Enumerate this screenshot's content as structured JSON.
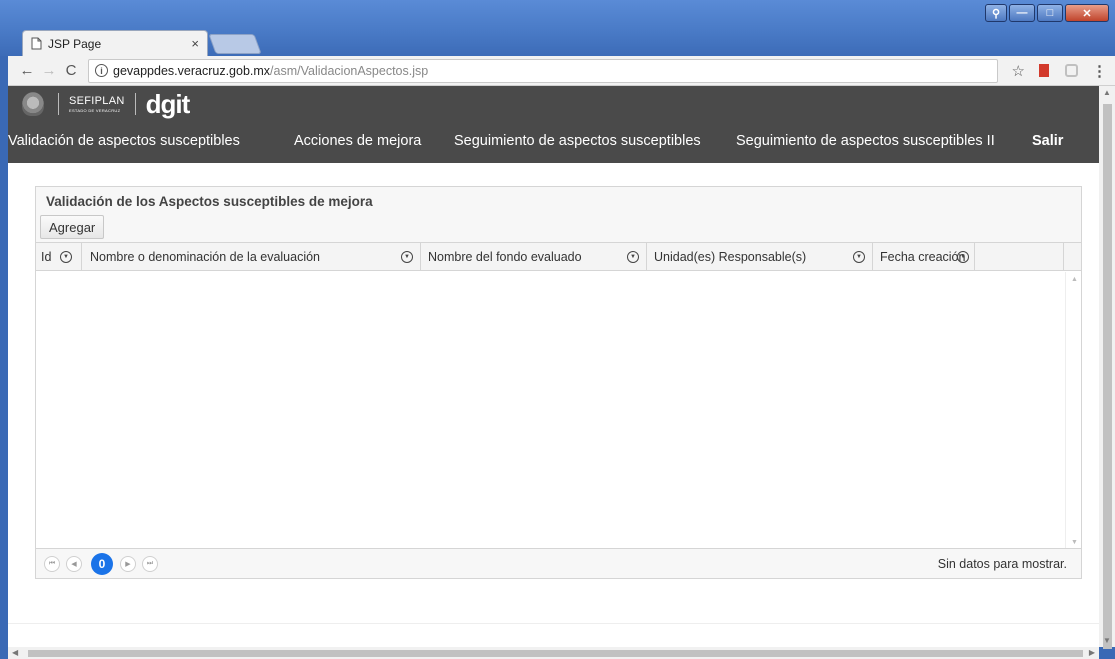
{
  "window": {
    "controls": {
      "user": "⚲",
      "minimize": "—",
      "maximize": "□",
      "close": "✕"
    }
  },
  "browser": {
    "tab_title": "JSP Page",
    "tab_close": "×",
    "url_host": "gevappdes.veracruz.gob.mx",
    "url_path": "/asm/ValidacionAspectos.jsp",
    "back": "←",
    "forward": "→",
    "reload": "C",
    "info": "i",
    "star": "☆",
    "menu": "⋮"
  },
  "header": {
    "logo_sefiplan": "SEFIPLAN",
    "logo_sefiplan_sub": "ESTADO DE VERACRUZ",
    "logo_dgit": "dgit",
    "menu": [
      {
        "label": "Validación de aspectos susceptibles"
      },
      {
        "label": "Acciones de mejora"
      },
      {
        "label": "Seguimiento de aspectos susceptibles"
      },
      {
        "label": "Seguimiento de aspectos susceptibles II"
      },
      {
        "label": "Salir"
      }
    ]
  },
  "panel": {
    "title": "Validación de los Aspectos susceptibles de mejora",
    "add_button": "Agregar",
    "columns": [
      {
        "label": "Id"
      },
      {
        "label": "Nombre o denominación de la evaluación"
      },
      {
        "label": "Nombre del fondo evaluado"
      },
      {
        "label": "Unidad(es) Responsable(s)"
      },
      {
        "label": "Fecha creación"
      }
    ],
    "rows": [],
    "pager": {
      "current_page": "0",
      "first": "⏮",
      "prev": "◀",
      "next": "▶",
      "last": "⏭",
      "info": "Sin datos para mostrar."
    }
  }
}
